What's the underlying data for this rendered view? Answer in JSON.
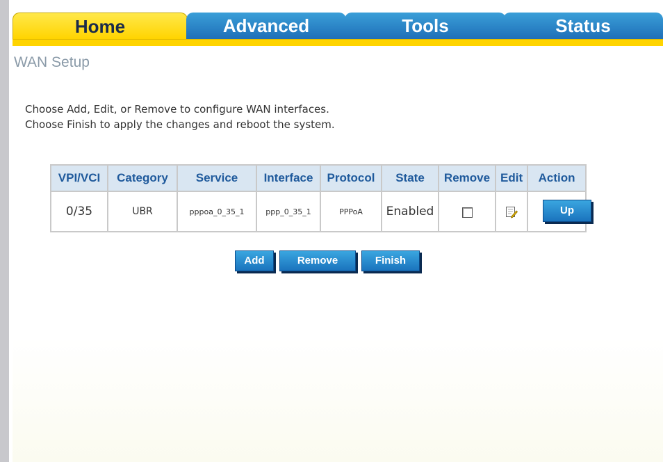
{
  "nav": {
    "tabs": [
      "Home",
      "Advanced",
      "Tools",
      "Status"
    ],
    "active_tab": "Home"
  },
  "page": {
    "title": "WAN Setup",
    "description_line1": "Choose Add, Edit, or Remove to configure WAN interfaces.",
    "description_line2": "Choose Finish to apply the changes and reboot the system."
  },
  "table": {
    "headers": [
      "VPI/VCI",
      "Category",
      "Service",
      "Interface",
      "Protocol",
      "State",
      "Remove",
      "Edit",
      "Action"
    ],
    "rows": [
      {
        "vpi_vci": "0/35",
        "category": "UBR",
        "service": "pppoa_0_35_1",
        "interface": "ppp_0_35_1",
        "protocol": "PPPoA",
        "state": "Enabled",
        "remove_checked": false,
        "edit_icon": "edit-icon",
        "action_label": "Up"
      }
    ]
  },
  "buttons": {
    "add": "Add",
    "remove": "Remove",
    "finish": "Finish"
  },
  "colors": {
    "active_tab": "#ffd400",
    "inactive_tab": "#1f6fb8",
    "header_text": "#1f5a9c",
    "button": "#1a73bd"
  }
}
